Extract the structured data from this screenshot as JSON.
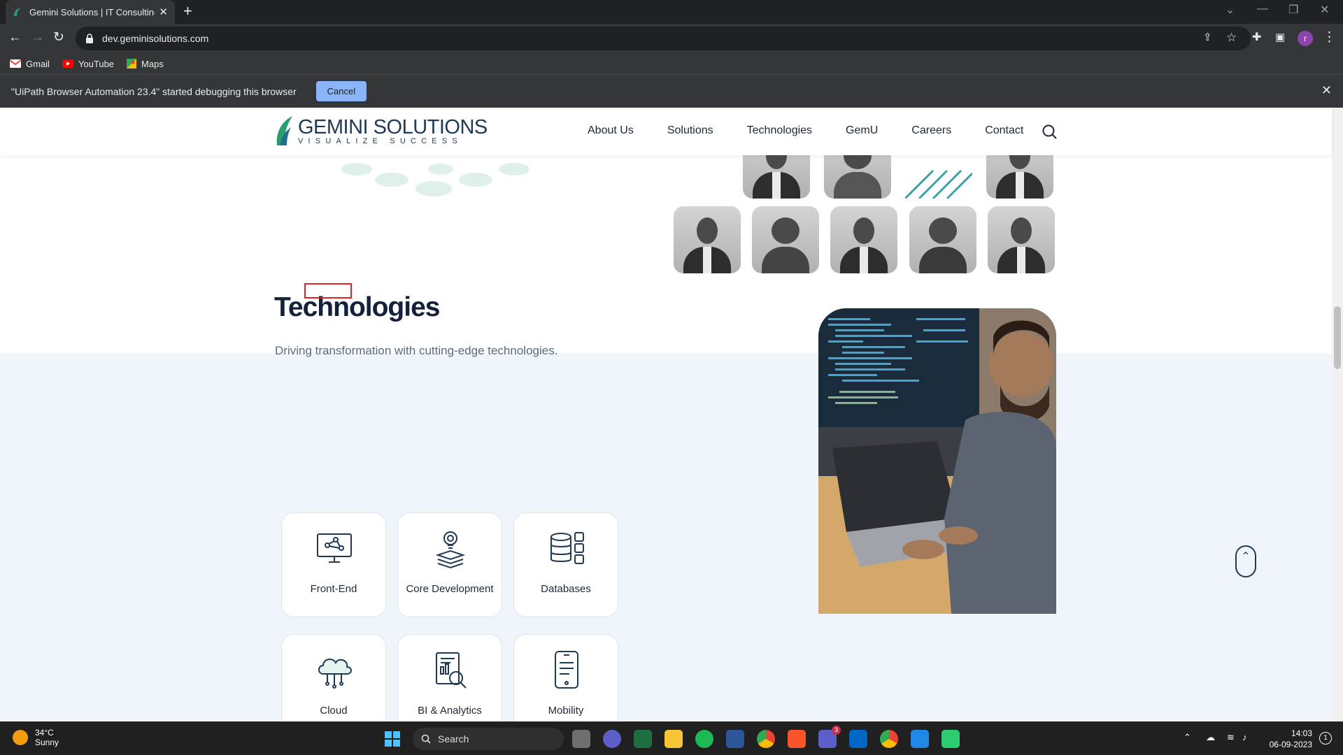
{
  "browser": {
    "tab_title": "Gemini Solutions | IT Consulting,",
    "url": "dev.geminisolutions.com",
    "bookmarks": [
      "Gmail",
      "YouTube",
      "Maps"
    ],
    "profile_initial": "r",
    "infobar_text": "\"UiPath Browser Automation 23.4\" started debugging this browser",
    "infobar_cancel": "Cancel"
  },
  "site": {
    "logo_main": "GEMINI SOLUTIONS",
    "logo_tagline": "VISUALIZE SUCCESS",
    "nav": [
      "About Us",
      "Solutions",
      "Technologies",
      "GemU",
      "Careers",
      "Contact"
    ]
  },
  "tech": {
    "title": "Technologies",
    "subtitle": "Driving transformation with cutting-edge technologies.",
    "cards": [
      {
        "label": "Front-End",
        "icon": "monitor-network-icon"
      },
      {
        "label": "Core Development",
        "icon": "lightbulb-layers-icon"
      },
      {
        "label": "Databases",
        "icon": "database-icon"
      },
      {
        "label": "Cloud",
        "icon": "cloud-icon"
      },
      {
        "label": "BI & Analytics",
        "icon": "report-search-icon"
      },
      {
        "label": "Mobility",
        "icon": "mobile-icon"
      }
    ]
  },
  "taskbar": {
    "temp": "34°C",
    "weather": "Sunny",
    "search": "Search",
    "time": "14:03",
    "date": "06-09-2023",
    "teams_badge": "3",
    "notif_count": "1"
  },
  "colors": {
    "brand_dark": "#1f3a56",
    "brand_green": "#2a9d6f",
    "section_bg": "#f0f5fc",
    "highlight": "#e02424"
  }
}
